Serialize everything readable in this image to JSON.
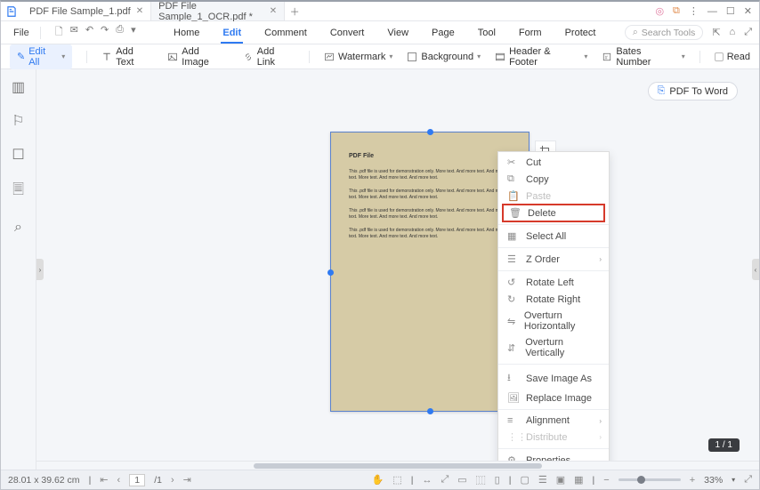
{
  "tabs": [
    {
      "label": "PDF File Sample_1.pdf"
    },
    {
      "label": "PDF File Sample_1_OCR.pdf *"
    }
  ],
  "menubar": {
    "file": "File"
  },
  "main_tabs": [
    "Home",
    "Edit",
    "Comment",
    "Convert",
    "View",
    "Page",
    "Tool",
    "Form",
    "Protect"
  ],
  "main_active": 1,
  "search_placeholder": "Search Tools",
  "toolbar": {
    "edit_all": "Edit All",
    "add_text": "Add Text",
    "add_image": "Add Image",
    "add_link": "Add Link",
    "watermark": "Watermark",
    "background": "Background",
    "header_footer": "Header & Footer",
    "bates_number": "Bates Number",
    "read": "Read"
  },
  "pdf_to_word": "PDF To Word",
  "page_content": {
    "title": "PDF File",
    "para": "This .pdf file is used for demonstration only. More text. And more text. And more text. More text. And more text. And more text."
  },
  "context_menu": {
    "cut": "Cut",
    "copy": "Copy",
    "paste": "Paste",
    "delete": "Delete",
    "select_all": "Select All",
    "z_order": "Z Order",
    "rotate_left": "Rotate Left",
    "rotate_right": "Rotate Right",
    "overturn_h": "Overturn Horizontally",
    "overturn_v": "Overturn Vertically",
    "save_image_as": "Save Image As",
    "replace_image": "Replace Image",
    "alignment": "Alignment",
    "distribute": "Distribute",
    "properties": "Properties"
  },
  "page_indicator": "1 / 1",
  "statusbar": {
    "dimensions": "28.01 x 39.62 cm",
    "page": "1",
    "total": "/1",
    "zoom": "33%"
  }
}
